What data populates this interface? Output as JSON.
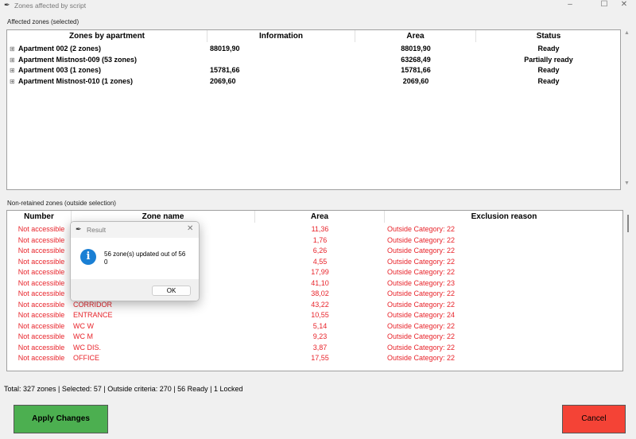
{
  "window": {
    "title": "Zones affected by script",
    "minimize": "–",
    "maximize": "☐",
    "close": "✕"
  },
  "affected": {
    "label": "Affected zones (selected)",
    "headers": [
      "Zones by apartment",
      "Information",
      "Area",
      "Status"
    ],
    "rows": [
      {
        "name": "Apartment 002 (2 zones)",
        "info": "88019,90",
        "area": "88019,90",
        "status": "Ready"
      },
      {
        "name": "Apartment Mistnost-009 (53 zones)",
        "info": "",
        "area": "63268,49",
        "status": "Partially ready"
      },
      {
        "name": "Apartment 003 (1 zones)",
        "info": "15781,66",
        "area": "15781,66",
        "status": "Ready"
      },
      {
        "name": "Apartment Mistnost-010 (1 zones)",
        "info": "2069,60",
        "area": "2069,60",
        "status": "Ready"
      }
    ]
  },
  "nonretained": {
    "label": "Non-retained zones (outside selection)",
    "headers": [
      "Number",
      "Zone name",
      "Area",
      "Exclusion reason"
    ],
    "rows": [
      {
        "number": "Not accessible",
        "name": "",
        "area": "11,36",
        "reason": "Outside Category: 22"
      },
      {
        "number": "Not accessible",
        "name": "",
        "area": "1,76",
        "reason": "Outside Category: 22"
      },
      {
        "number": "Not accessible",
        "name": "",
        "area": "6,26",
        "reason": "Outside Category: 22"
      },
      {
        "number": "Not accessible",
        "name": "",
        "area": "4,55",
        "reason": "Outside Category: 22"
      },
      {
        "number": "Not accessible",
        "name": "",
        "area": "17,99",
        "reason": "Outside Category: 22"
      },
      {
        "number": "Not accessible",
        "name": "",
        "area": "41,10",
        "reason": "Outside Category: 23"
      },
      {
        "number": "Not accessible",
        "name": "",
        "area": "38,02",
        "reason": "Outside Category: 22"
      },
      {
        "number": "Not accessible",
        "name": "CORRIDOR",
        "area": "43,22",
        "reason": "Outside Category: 22"
      },
      {
        "number": "Not accessible",
        "name": "ENTRANCE",
        "area": "10,55",
        "reason": "Outside Category: 24"
      },
      {
        "number": "Not accessible",
        "name": "WC W",
        "area": "5,14",
        "reason": "Outside Category: 22"
      },
      {
        "number": "Not accessible",
        "name": "WC M",
        "area": "9,23",
        "reason": "Outside Category: 22"
      },
      {
        "number": "Not accessible",
        "name": "WC DIS.",
        "area": "3,87",
        "reason": "Outside Category: 22"
      },
      {
        "number": "Not accessible",
        "name": "OFFICE",
        "area": "17,55",
        "reason": "Outside Category: 22"
      }
    ]
  },
  "dialog": {
    "title": "Result",
    "message_line1": "56 zone(s) updated out of 56",
    "message_line2": "0",
    "ok": "OK",
    "close": "✕",
    "info_glyph": "i"
  },
  "status": "Total: 327 zones | Selected: 57 | Outside criteria: 270 | 56 Ready | 1 Locked",
  "buttons": {
    "apply": "Apply Changes",
    "cancel": "Cancel"
  },
  "colors": {
    "apply": "#4caf50",
    "cancel": "#f44336",
    "excluded_text": "#e8242b"
  }
}
